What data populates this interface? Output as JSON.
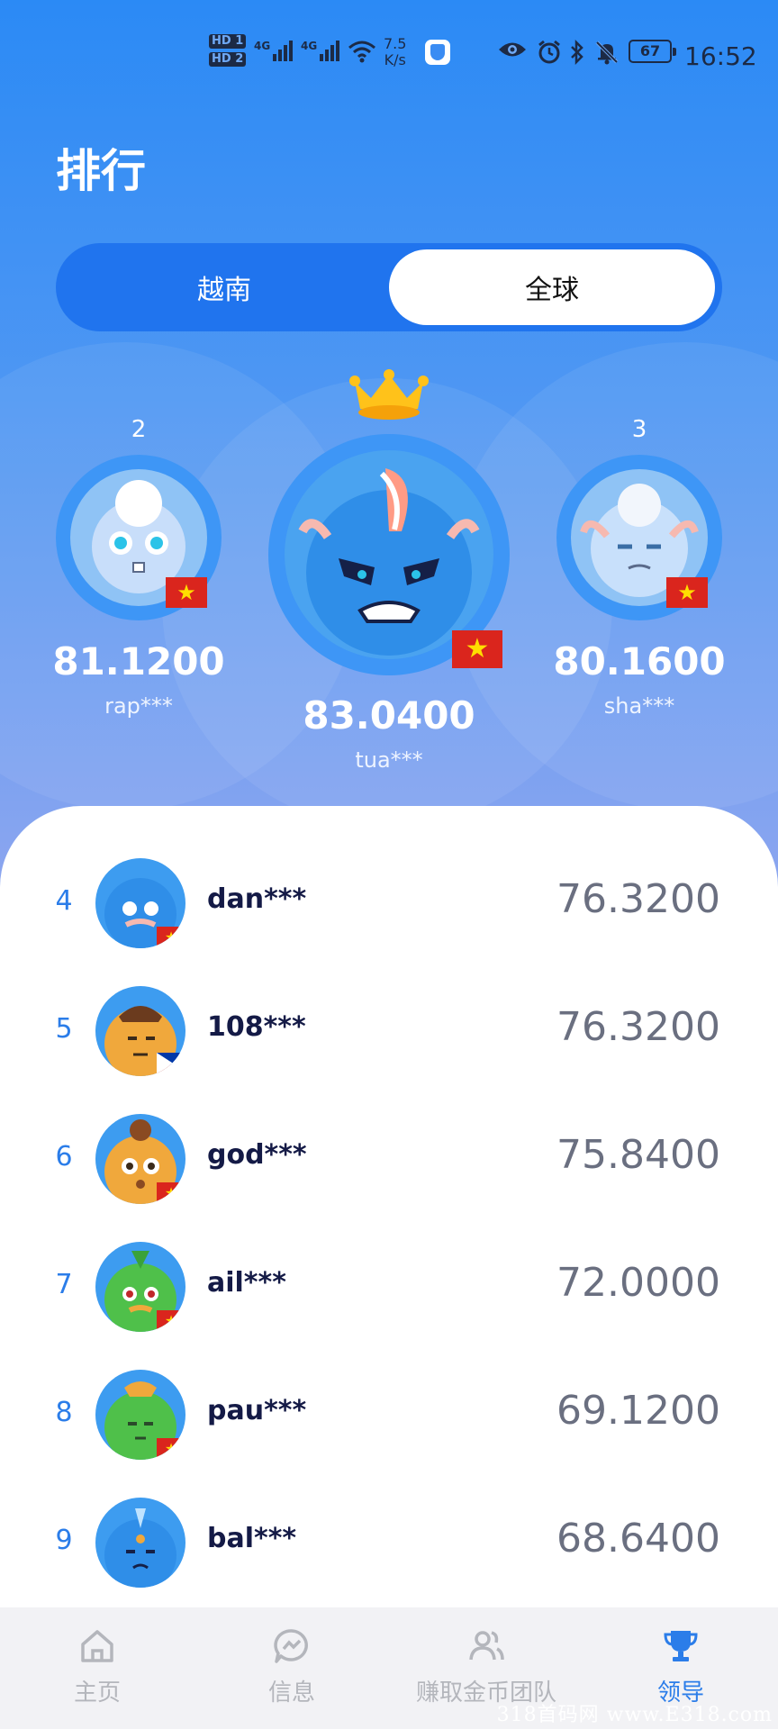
{
  "status_bar": {
    "sim1": "HD 1",
    "sim2": "HD 2",
    "net1": "4G",
    "net2": "4G",
    "speed_value": "7.5",
    "speed_unit": "K/s",
    "battery": "67",
    "time": "16:52"
  },
  "page_title": "排行",
  "segment": {
    "left_label": "越南",
    "right_label": "全球",
    "selected": "全球"
  },
  "podium": {
    "first": {
      "rank": "1",
      "score": "83.0400",
      "user": "tua***",
      "flag": "vietnam"
    },
    "second": {
      "rank": "2",
      "score": "81.1200",
      "user": "rap***",
      "flag": "vietnam"
    },
    "third": {
      "rank": "3",
      "score": "80.1600",
      "user": "sha***",
      "flag": "vietnam"
    }
  },
  "list": [
    {
      "rank": "4",
      "user": "dan***",
      "score": "76.3200",
      "flag": "vietnam",
      "avatar_color": "#3d9cf0"
    },
    {
      "rank": "5",
      "user": "108***",
      "score": "76.3200",
      "flag": "philippines",
      "avatar_color": "#f0a83c"
    },
    {
      "rank": "6",
      "user": "god***",
      "score": "75.8400",
      "flag": "vietnam",
      "avatar_color": "#f0a83c"
    },
    {
      "rank": "7",
      "user": "ail***",
      "score": "72.0000",
      "flag": "vietnam",
      "avatar_color": "#4fc04a"
    },
    {
      "rank": "8",
      "user": "pau***",
      "score": "69.1200",
      "flag": "vietnam",
      "avatar_color": "#4fc04a"
    },
    {
      "rank": "9",
      "user": "bal***",
      "score": "68.6400",
      "flag": "vietnam",
      "avatar_color": "#3d9cf0"
    }
  ],
  "tabs": [
    {
      "label": "主页",
      "icon": "home-icon"
    },
    {
      "label": "信息",
      "icon": "chat-icon"
    },
    {
      "label": "赚取金币团队",
      "icon": "team-icon"
    },
    {
      "label": "领导",
      "icon": "trophy-icon",
      "active": true
    }
  ],
  "watermark": "318首码网 www.E318.com",
  "colors": {
    "accent": "#2b7de9",
    "header_top": "#2b8af5",
    "header_bottom": "#8ea6ef"
  }
}
